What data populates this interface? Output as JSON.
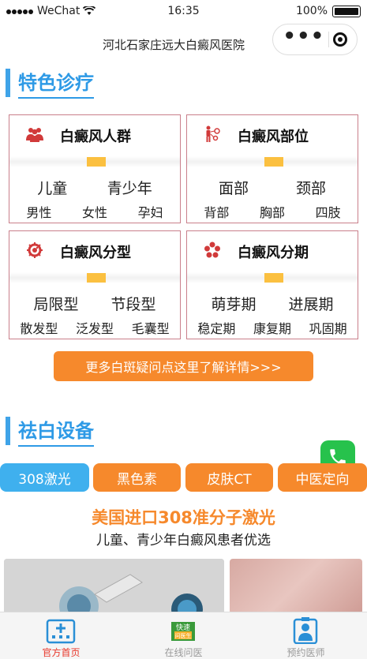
{
  "status": {
    "carrier": "WeChat",
    "time": "16:35",
    "battery": "100%"
  },
  "nav": {
    "title": "河北石家庄远大白癜风医院"
  },
  "section1": {
    "title": "特色诊疗"
  },
  "cards": [
    {
      "title": "白癜风人群",
      "icon": "people-icon",
      "row1": [
        "儿童",
        "青少年"
      ],
      "row2": [
        "男性",
        "女性",
        "孕妇"
      ]
    },
    {
      "title": "白癜风部位",
      "icon": "body-part-icon",
      "row1": [
        "面部",
        "颈部"
      ],
      "row2": [
        "背部",
        "胸部",
        "四肢"
      ]
    },
    {
      "title": "白癜风分型",
      "icon": "virus-icon",
      "row1": [
        "局限型",
        "节段型"
      ],
      "row2": [
        "散发型",
        "泛发型",
        "毛囊型"
      ]
    },
    {
      "title": "白癜风分期",
      "icon": "flower-icon",
      "row1": [
        "萌芽期",
        "进展期"
      ],
      "row2": [
        "稳定期",
        "康复期",
        "巩固期"
      ]
    }
  ],
  "more_button": "更多白斑疑问点这里了解详情>>>",
  "section2": {
    "title": "祛白设备"
  },
  "tabs": [
    "308激光",
    "黑色素",
    "皮肤CT",
    "中医定向"
  ],
  "headline": "美国进口308准分子激光",
  "subline": "儿童、青少年白癜风患者优选",
  "tabbar": [
    {
      "label": "官方首页",
      "icon": "hospital-icon"
    },
    {
      "label": "在线问医",
      "icon": "consult-icon",
      "badge_top": "快速",
      "badge_bottom": "问医生"
    },
    {
      "label": "预约医师",
      "icon": "doctor-icon"
    }
  ],
  "colors": {
    "accent_blue": "#2e9ae6",
    "orange": "#f6892c",
    "active_tab": "#3fb0ee",
    "card_border": "#c97f8b",
    "active_label": "#e8372a"
  }
}
